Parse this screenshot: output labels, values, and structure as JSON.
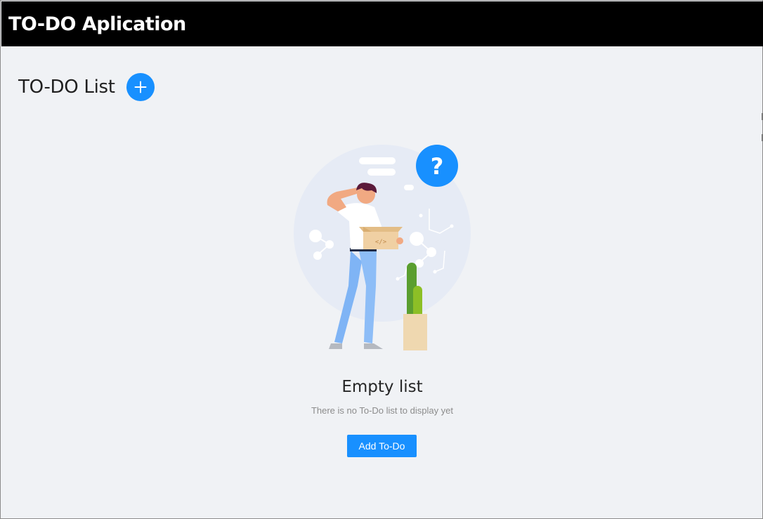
{
  "app": {
    "title": "TO-DO Aplication"
  },
  "list": {
    "title": "TO-DO List",
    "add_icon": "plus-icon"
  },
  "empty_state": {
    "illustration": "confused-person-with-box-illustration",
    "title": "Empty list",
    "description": "There is no To-Do list to display yet",
    "button_label": "Add To-Do"
  },
  "colors": {
    "header_bg": "#000000",
    "page_bg": "#f0f2f5",
    "primary": "#1890ff"
  }
}
